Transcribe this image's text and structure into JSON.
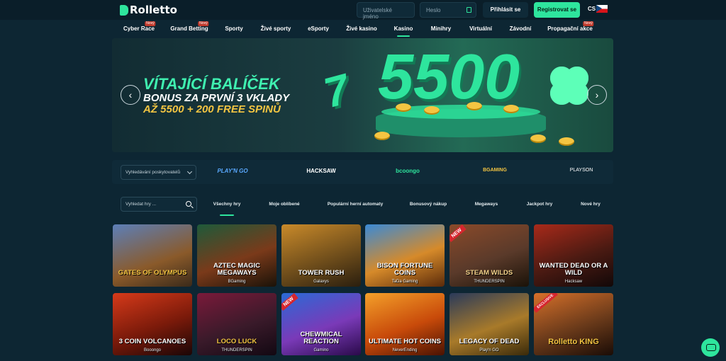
{
  "header": {
    "logo_text": "Rolletto",
    "username_placeholder": "Uživatelské jméno",
    "password_placeholder": "Heslo",
    "login_label": "Přihlásit se",
    "register_label": "Registrovat se",
    "language": "CS"
  },
  "nav": {
    "new_badge": "Nový",
    "items": [
      {
        "label": "Cyber Race",
        "badge": true
      },
      {
        "label": "Grand Betting",
        "badge": true
      },
      {
        "label": "Sporty",
        "badge": false
      },
      {
        "label": "Živé sporty",
        "badge": false
      },
      {
        "label": "eSporty",
        "badge": false
      },
      {
        "label": "Živé kasino",
        "badge": false
      },
      {
        "label": "Kasino",
        "badge": false,
        "active": true
      },
      {
        "label": "Minihry",
        "badge": false
      },
      {
        "label": "Virtuální",
        "badge": false
      },
      {
        "label": "Závodní",
        "badge": false
      },
      {
        "label": "Propagační akce",
        "badge": true
      }
    ]
  },
  "banner": {
    "line1": "VÍTAJÍCÍ BALÍČEK",
    "line2": "BONUS ZA PRVNÍ 3 VKLADY",
    "line3": "AŽ 5500 + 200 FREE SPINŮ",
    "big_number": "5500",
    "prev_icon": "chevron-left-icon",
    "next_icon": "chevron-right-icon"
  },
  "providers": {
    "search_placeholder": "Vyhledávání poskytovatelů",
    "logos": [
      "PLAY'N GO",
      "HACKSAW",
      "bcoongo",
      "BGAMING",
      "PLAYSON"
    ]
  },
  "games_bar": {
    "search_placeholder": "Vyhledat hry ...",
    "tabs": [
      "Všechny hry",
      "Moje oblíbené",
      "Populární herní automaty",
      "Bonusový nákup",
      "Megaways",
      "Jackpot hry",
      "Nové hry"
    ],
    "active_tab": "Všechny hry"
  },
  "games": [
    {
      "title": "GATES OF OLYMPUS",
      "provider": "",
      "badge": ""
    },
    {
      "title": "AZTEC MAGIC MEGAWAYS",
      "provider": "BGaming",
      "badge": ""
    },
    {
      "title": "TOWER RUSH",
      "provider": "Galaxys",
      "badge": ""
    },
    {
      "title": "BISON FORTUNE COINS",
      "provider": "TaDa Gaming",
      "badge": ""
    },
    {
      "title": "STEAM WILDS",
      "provider": "THUNDERSPIN",
      "badge": "NEW"
    },
    {
      "title": "WANTED DEAD OR A WILD",
      "provider": "Hacksaw",
      "badge": ""
    },
    {
      "title": "3 COIN VOLCANOES",
      "provider": "Booongo",
      "badge": ""
    },
    {
      "title": "LOCO LUCK",
      "provider": "THUNDERSPIN",
      "badge": ""
    },
    {
      "title": "CHEWMICAL REACTION",
      "provider": "Gamino",
      "badge": "NEW"
    },
    {
      "title": "ULTIMATE HOT COINS",
      "provider": "NeverEnding",
      "badge": ""
    },
    {
      "title": "LEGACY OF DEAD",
      "provider": "Play'n GO",
      "badge": ""
    },
    {
      "title": "Rolletto KING",
      "provider": "",
      "badge": "EXCLUSIVE"
    }
  ],
  "colors": {
    "accent": "#2ee59d",
    "background": "#0d2633",
    "badge": "#d6262e"
  }
}
